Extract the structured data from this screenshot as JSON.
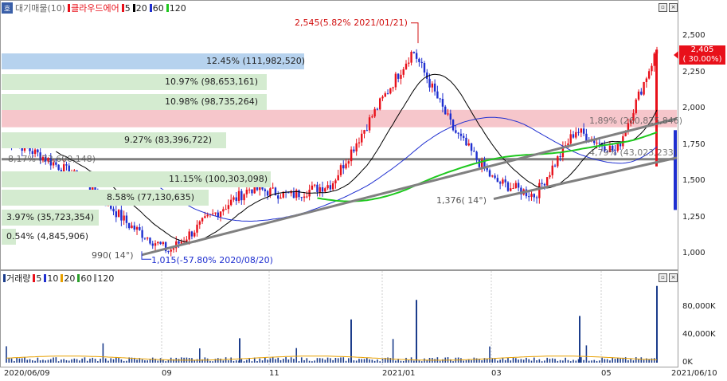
{
  "price_legend": {
    "icon": "호",
    "vp_label": "대기매물(10)",
    "stock_name": "클라우드에어",
    "ma": [
      {
        "period": "5",
        "color": "#e8101a"
      },
      {
        "period": "20",
        "color": "#000000"
      },
      {
        "period": "60",
        "color": "#1f2fd0"
      },
      {
        "period": "120",
        "color": "#1ec81e"
      }
    ]
  },
  "volume_legend": {
    "label": "거래량",
    "ma": [
      {
        "period": "5",
        "color": "#e8101a"
      },
      {
        "period": "10",
        "color": "#1f2fd0"
      },
      {
        "period": "20",
        "color": "#e8a000"
      },
      {
        "period": "60",
        "color": "#2aa02a"
      },
      {
        "period": "120",
        "color": "#999999"
      }
    ]
  },
  "price_axis_ticks": [
    "2,500",
    "2,250",
    "2,000",
    "1,750",
    "1,500",
    "1,250",
    "1,000"
  ],
  "volume_axis_ticks": [
    "80,000K",
    "40,000K",
    "0K"
  ],
  "date_axis": [
    "2020/06/09",
    "09",
    "11",
    "2021/01",
    "03",
    "05",
    "2021/06/10"
  ],
  "current_price": {
    "value": "2,405",
    "change": "( 30.00%)"
  },
  "annotations": {
    "high": "2,545(5.82% 2021/01/21)",
    "low": "1,015(-57.80% 2020/08/20)",
    "trend1": "990( 14°)",
    "trend2": "1,376( 14°)",
    "overlap1": "1,89% (260,825,846)",
    "overlap2": "4,79% (43,023,233)",
    "overlap3": "8,17% (73,600,148)"
  },
  "volume_profile": [
    {
      "label": "12.45% (111,982,520)",
      "color": "#b6d2ee"
    },
    {
      "label": "10.97% (98,653,161)",
      "color": "#d4ebd0"
    },
    {
      "label": "10.98% (98,735,264)",
      "color": "#d4ebd0"
    },
    {
      "label": "9.27% (83,396,722)",
      "color": "#d4ebd0"
    },
    {
      "label": "11.15% (100,303,098)",
      "color": "#d4ebd0"
    },
    {
      "label": "8.58% (77,130,635)",
      "color": "#d4ebd0"
    },
    {
      "label": "3.97% (35,723,354)",
      "color": "#d4ebd0"
    },
    {
      "label": "0.54% (4,845,906)",
      "color": "#d4ebd0"
    }
  ],
  "chart_data": {
    "type": "candlestick",
    "x": [
      "2020/06/09",
      "2020/06",
      "2020/07",
      "2020/08",
      "2020/08/20",
      "2020/09",
      "2020/10",
      "2020/11",
      "2020/12",
      "2021/01",
      "2021/01/21",
      "2021/02",
      "2021/03",
      "2021/04",
      "2021/05",
      "2021/06",
      "2021/06/10"
    ],
    "close": [
      1800,
      1650,
      1480,
      1200,
      1015,
      1250,
      1450,
      1400,
      1480,
      1950,
      2400,
      1850,
      1500,
      1400,
      1850,
      1700,
      2405
    ],
    "ylim": [
      950,
      2600
    ],
    "volume_ylim": [
      0,
      110000
    ],
    "horizontal_line": 1650,
    "highlight_band": [
      1870,
      1990
    ]
  }
}
